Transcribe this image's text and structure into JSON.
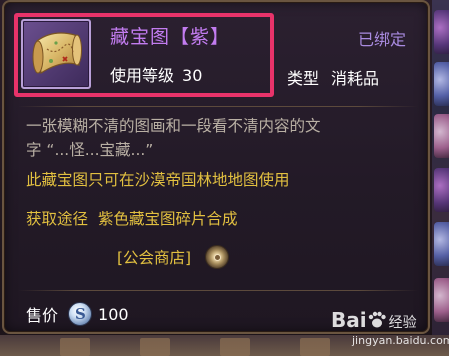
{
  "item": {
    "name": "藏宝图【紫】",
    "bound_status": "已绑定",
    "level_label": "使用等级",
    "level_value": "30",
    "type_label": "类型",
    "type_value": "消耗品",
    "icon": "treasure-map-scroll-icon"
  },
  "description": {
    "line1": "一张模糊不清的图画和一段看不清内容的文",
    "line2": "字 “...怪...宝藏...”",
    "usage": "此藏宝图只可在沙漠帝国林地地图使用"
  },
  "source": {
    "label": "获取途径",
    "value": "紫色藏宝图碎片合成",
    "shop": "[公会商店]",
    "locate_icon": "locate-icon"
  },
  "price": {
    "label": "售价",
    "currency_icon": "silver-coin-icon",
    "value": "100"
  },
  "watermark": {
    "logo_text": "Bai",
    "logo_text2": "经验",
    "url": "jingyan.baidu.com"
  },
  "colors": {
    "name_purple": "#c27cf0",
    "bound_purple": "#a98be0",
    "highlight_red": "#e8336a",
    "desc_gray": "#b9b0a4",
    "yellow": "#e2c040"
  }
}
